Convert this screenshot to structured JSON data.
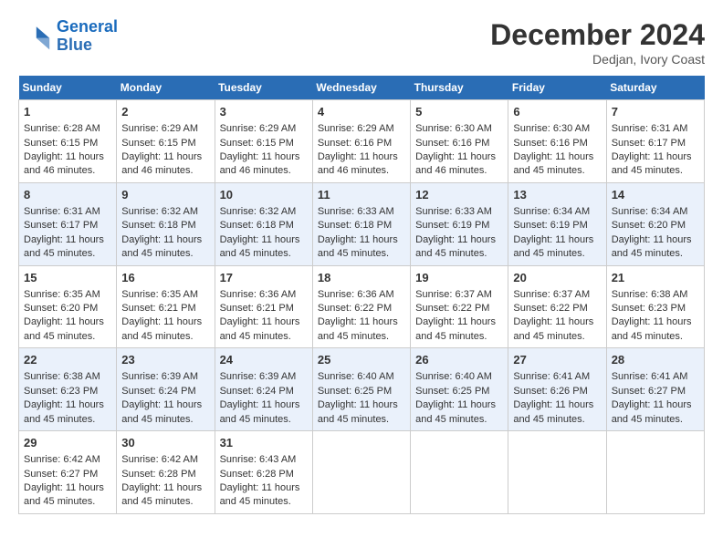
{
  "header": {
    "logo_line1": "General",
    "logo_line2": "Blue",
    "month": "December 2024",
    "location": "Dedjan, Ivory Coast"
  },
  "weekdays": [
    "Sunday",
    "Monday",
    "Tuesday",
    "Wednesday",
    "Thursday",
    "Friday",
    "Saturday"
  ],
  "weeks": [
    [
      {
        "day": "1",
        "rise": "6:28 AM",
        "set": "6:15 PM",
        "light": "11 hours and 46 minutes."
      },
      {
        "day": "2",
        "rise": "6:29 AM",
        "set": "6:15 PM",
        "light": "11 hours and 46 minutes."
      },
      {
        "day": "3",
        "rise": "6:29 AM",
        "set": "6:15 PM",
        "light": "11 hours and 46 minutes."
      },
      {
        "day": "4",
        "rise": "6:29 AM",
        "set": "6:16 PM",
        "light": "11 hours and 46 minutes."
      },
      {
        "day": "5",
        "rise": "6:30 AM",
        "set": "6:16 PM",
        "light": "11 hours and 46 minutes."
      },
      {
        "day": "6",
        "rise": "6:30 AM",
        "set": "6:16 PM",
        "light": "11 hours and 45 minutes."
      },
      {
        "day": "7",
        "rise": "6:31 AM",
        "set": "6:17 PM",
        "light": "11 hours and 45 minutes."
      }
    ],
    [
      {
        "day": "8",
        "rise": "6:31 AM",
        "set": "6:17 PM",
        "light": "11 hours and 45 minutes."
      },
      {
        "day": "9",
        "rise": "6:32 AM",
        "set": "6:18 PM",
        "light": "11 hours and 45 minutes."
      },
      {
        "day": "10",
        "rise": "6:32 AM",
        "set": "6:18 PM",
        "light": "11 hours and 45 minutes."
      },
      {
        "day": "11",
        "rise": "6:33 AM",
        "set": "6:18 PM",
        "light": "11 hours and 45 minutes."
      },
      {
        "day": "12",
        "rise": "6:33 AM",
        "set": "6:19 PM",
        "light": "11 hours and 45 minutes."
      },
      {
        "day": "13",
        "rise": "6:34 AM",
        "set": "6:19 PM",
        "light": "11 hours and 45 minutes."
      },
      {
        "day": "14",
        "rise": "6:34 AM",
        "set": "6:20 PM",
        "light": "11 hours and 45 minutes."
      }
    ],
    [
      {
        "day": "15",
        "rise": "6:35 AM",
        "set": "6:20 PM",
        "light": "11 hours and 45 minutes."
      },
      {
        "day": "16",
        "rise": "6:35 AM",
        "set": "6:21 PM",
        "light": "11 hours and 45 minutes."
      },
      {
        "day": "17",
        "rise": "6:36 AM",
        "set": "6:21 PM",
        "light": "11 hours and 45 minutes."
      },
      {
        "day": "18",
        "rise": "6:36 AM",
        "set": "6:22 PM",
        "light": "11 hours and 45 minutes."
      },
      {
        "day": "19",
        "rise": "6:37 AM",
        "set": "6:22 PM",
        "light": "11 hours and 45 minutes."
      },
      {
        "day": "20",
        "rise": "6:37 AM",
        "set": "6:22 PM",
        "light": "11 hours and 45 minutes."
      },
      {
        "day": "21",
        "rise": "6:38 AM",
        "set": "6:23 PM",
        "light": "11 hours and 45 minutes."
      }
    ],
    [
      {
        "day": "22",
        "rise": "6:38 AM",
        "set": "6:23 PM",
        "light": "11 hours and 45 minutes."
      },
      {
        "day": "23",
        "rise": "6:39 AM",
        "set": "6:24 PM",
        "light": "11 hours and 45 minutes."
      },
      {
        "day": "24",
        "rise": "6:39 AM",
        "set": "6:24 PM",
        "light": "11 hours and 45 minutes."
      },
      {
        "day": "25",
        "rise": "6:40 AM",
        "set": "6:25 PM",
        "light": "11 hours and 45 minutes."
      },
      {
        "day": "26",
        "rise": "6:40 AM",
        "set": "6:25 PM",
        "light": "11 hours and 45 minutes."
      },
      {
        "day": "27",
        "rise": "6:41 AM",
        "set": "6:26 PM",
        "light": "11 hours and 45 minutes."
      },
      {
        "day": "28",
        "rise": "6:41 AM",
        "set": "6:27 PM",
        "light": "11 hours and 45 minutes."
      }
    ],
    [
      {
        "day": "29",
        "rise": "6:42 AM",
        "set": "6:27 PM",
        "light": "11 hours and 45 minutes."
      },
      {
        "day": "30",
        "rise": "6:42 AM",
        "set": "6:28 PM",
        "light": "11 hours and 45 minutes."
      },
      {
        "day": "31",
        "rise": "6:43 AM",
        "set": "6:28 PM",
        "light": "11 hours and 45 minutes."
      },
      null,
      null,
      null,
      null
    ]
  ]
}
